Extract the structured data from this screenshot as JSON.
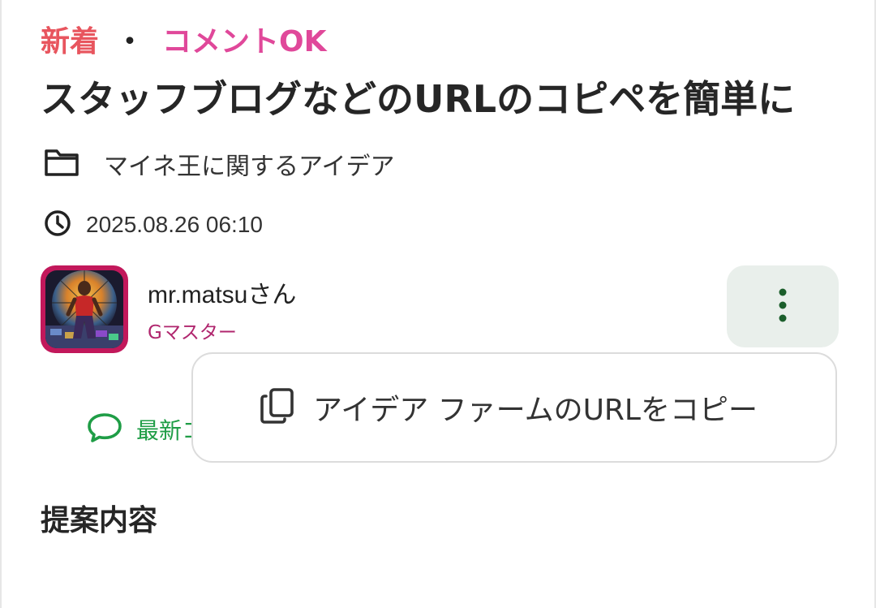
{
  "post": {
    "tag_new": "新着",
    "tag_separator": "・",
    "tag_comment_ok": "コメントOK",
    "title": "スタッフブログなどのURLのコピペを簡単に",
    "category": "マイネ王に関するアイデア",
    "datetime": "2025.08.26 06:10",
    "author": {
      "name": "mr.matsuさん",
      "rank": "Gマスター"
    },
    "latest_comment_label": "最新コ",
    "section_heading": "提案内容"
  },
  "menu": {
    "copy_url_label": "アイデア ファームのURLをコピー"
  },
  "icons": {
    "category": "folder-icon",
    "date": "clock-icon",
    "comment": "speech-bubble-icon",
    "more": "more-vertical-icon",
    "copy": "copy-icon"
  },
  "colors": {
    "tag_new": "#e8555e",
    "tag_comment": "#e0489a",
    "rank": "#b0266e",
    "accent_green": "#1f9d46",
    "more_button_bg": "#e9efeb",
    "avatar_border": "#c2185b"
  }
}
